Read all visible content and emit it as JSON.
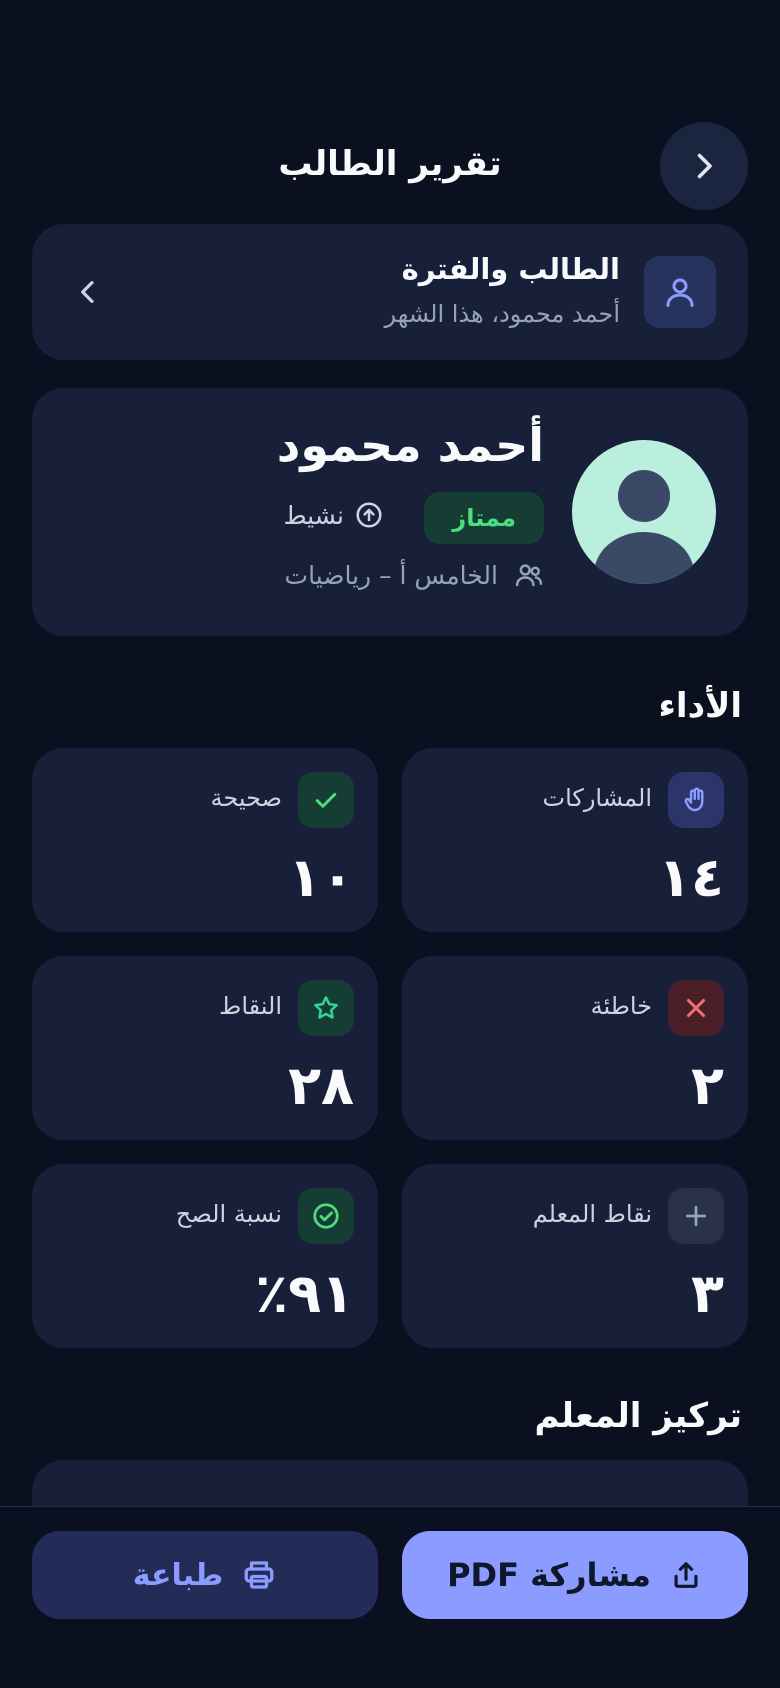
{
  "header": {
    "title": "تقرير الطالب"
  },
  "period": {
    "title": "الطالب والفترة",
    "subtitle": "أحمد محمود، هذا الشهر"
  },
  "profile": {
    "name": "أحمد محمود",
    "grade_badge": "ممتاز",
    "status": "نشيط",
    "class": "الخامس أ – رياضيات"
  },
  "performance": {
    "title": "الأداء",
    "stats": [
      {
        "label": "المشاركات",
        "value": "١٤",
        "icon": "hand-icon",
        "color": "#8b9bff"
      },
      {
        "label": "صحيحة",
        "value": "١٠",
        "icon": "check-icon",
        "color": "#4ade80"
      },
      {
        "label": "خاطئة",
        "value": "٢",
        "icon": "close-icon",
        "color": "#f87171"
      },
      {
        "label": "النقاط",
        "value": "٢٨",
        "icon": "star-icon",
        "color": "#34d399"
      },
      {
        "label": "نقاط المعلم",
        "value": "٣",
        "icon": "plus-icon",
        "color": "#94a3b8"
      },
      {
        "label": "نسبة الصح",
        "value": "٩١٪",
        "icon": "check-circle-icon",
        "color": "#4ade80"
      }
    ]
  },
  "teacher_focus": {
    "title": "تركيز المعلم"
  },
  "actions": {
    "share_label": "مشاركة PDF",
    "print_label": "طباعة"
  },
  "colors": {
    "background": "#0b1020",
    "card": "#182039",
    "accent": "#8b9bff",
    "success": "#4ade80",
    "danger": "#f87171"
  }
}
